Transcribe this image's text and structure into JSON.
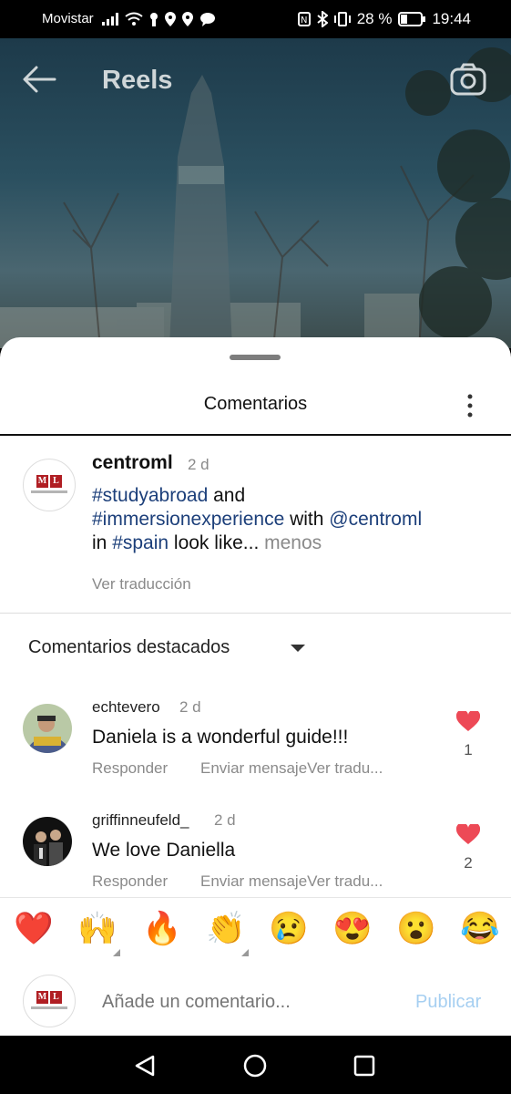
{
  "status_bar": {
    "carrier": "Movistar",
    "battery": "28 %",
    "time": "19:44"
  },
  "header": {
    "title": "Reels"
  },
  "sheet": {
    "title": "Comentarios",
    "post": {
      "username": "centroml",
      "time": "2 d",
      "caption_parts": [
        "#studyabroad",
        " and ",
        "#immersionexperience",
        " with ",
        "@centroml",
        " in ",
        "#spain",
        " look like... ",
        "menos"
      ],
      "translate": "Ver traducción"
    },
    "sort_label": "Comentarios destacados",
    "comments": [
      {
        "username": "echtevero",
        "time": "2 d",
        "text": "Daniela is a wonderful guide!!!",
        "reply": "Responder",
        "message": "Enviar mensajeVer tradu...",
        "likes": "1"
      },
      {
        "username": "griffinneufeld_",
        "time": "2 d",
        "text": "We love Daniella",
        "reply": "Responder",
        "message": "Enviar mensajeVer tradu...",
        "likes": "2"
      }
    ],
    "emojis": [
      "❤️",
      "🙌",
      "🔥",
      "👏",
      "😢",
      "😍",
      "😮",
      "😂"
    ],
    "composer": {
      "placeholder": "Añade un comentario...",
      "publish": "Publicar"
    }
  },
  "colors": {
    "like": "#ed4956",
    "link": "#1c3f7a",
    "publish": "#a6cff1"
  }
}
